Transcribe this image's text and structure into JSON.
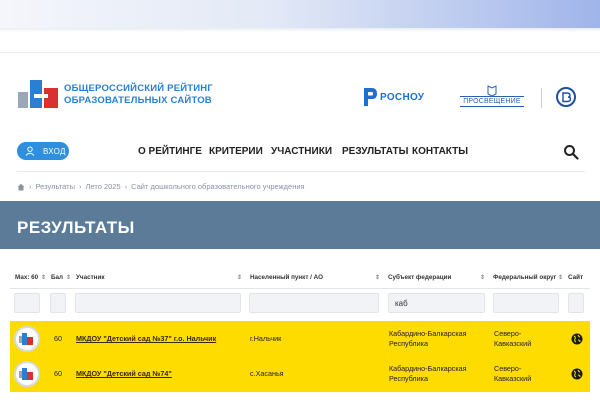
{
  "site": {
    "logo_lines": [
      "ОБЩЕРОССИЙСКИЙ РЕЙТИНГ",
      "ОБРАЗОВАТЕЛЬНЫХ САЙТОВ"
    ],
    "partners": [
      "РОСНОУ",
      "ПРОСВЕЩЕНИЕ"
    ]
  },
  "nav": {
    "login": "ВХОД",
    "items": [
      "О РЕЙТИНГЕ",
      "КРИТЕРИИ",
      "УЧАСТНИКИ",
      "РЕЗУЛЬТАТЫ",
      "КОНТАКТЫ"
    ]
  },
  "breadcrumb": [
    "Результаты",
    "Лето 2025",
    "Сайт дошкольного образовательного учреждения"
  ],
  "page_title": "РЕЗУЛЬТАТЫ",
  "table": {
    "columns": [
      "Мах: 60",
      "Бал",
      "Участник",
      "Населенный пункт / АО",
      "Субъект федерации",
      "Федеральный округ",
      "Сайт"
    ],
    "filters": [
      "",
      "",
      "",
      "",
      "каб",
      "",
      ""
    ],
    "rows": [
      {
        "score": "60",
        "participant": "МКДОУ \"Детский сад №37\" г.о. Нальчик",
        "locality": "г.Нальчик",
        "subject_lines": [
          "Кабардино-Балкарская",
          "Республика"
        ],
        "district_lines": [
          "Северо-",
          "Кавказский"
        ]
      },
      {
        "score": "60",
        "participant": "МКДОУ \"Детский сад №74\"",
        "locality": "с.Хасанья",
        "subject_lines": [
          "Кабардино-Балкарская",
          "Республика"
        ],
        "district_lines": [
          "Северо-",
          "Кавказский"
        ]
      }
    ]
  },
  "colors": {
    "accent": "#2e8fe0",
    "banner": "#5b7b98",
    "highlight_row": "#ffdc00"
  }
}
